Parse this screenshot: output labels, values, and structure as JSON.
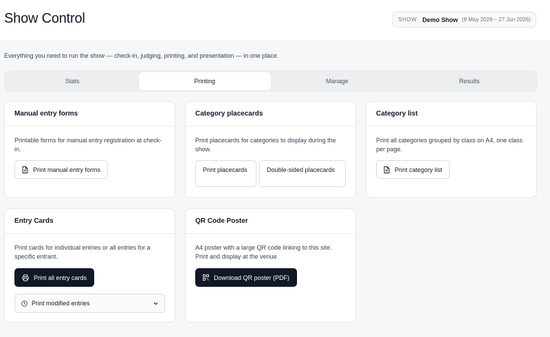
{
  "header": {
    "title": "Show Control",
    "show_label": "SHOW",
    "show_name": "Demo Show",
    "show_dates": "(8 May 2026 – 27 Jun 2026)"
  },
  "intro": "Everything you need to run the show — check-in, judging, printing, and presentation — in one place.",
  "tabs": [
    {
      "label": "Stats",
      "active": false
    },
    {
      "label": "Printing",
      "active": true
    },
    {
      "label": "Manage",
      "active": false
    },
    {
      "label": "Results",
      "active": false
    }
  ],
  "cards": {
    "manual": {
      "title": "Manual entry forms",
      "description": "Printable forms for manual entry registration at check-in.",
      "button": "Print manual entry forms",
      "icon": "document-icon"
    },
    "placecards": {
      "title": "Category placecards",
      "description": "Print placecards for categories to display during the show.",
      "button_1": "Print placecards",
      "button_2": "Double-sided placecards"
    },
    "catlist": {
      "title": "Category list",
      "description": "Print all categories grouped by class on A4, one class per page.",
      "button": "Print category list",
      "icon": "document-icon"
    },
    "entry": {
      "title": "Entry Cards",
      "description": "Print cards for individual entries or all entries for a specific entrant.",
      "button": "Print all entry cards",
      "icon": "printer-icon",
      "select": "Print modified entries",
      "select_icon": "clock-icon"
    },
    "qr": {
      "title": "QR Code Poster",
      "description": "A4 poster with a large QR code linking to this site. Print and display at the venue.",
      "button": "Download QR poster (PDF)",
      "icon": "qr-code-icon"
    }
  },
  "colors": {
    "background": "#f6f7f8",
    "dark_button": "#111827",
    "border": "#e5e7eb"
  }
}
